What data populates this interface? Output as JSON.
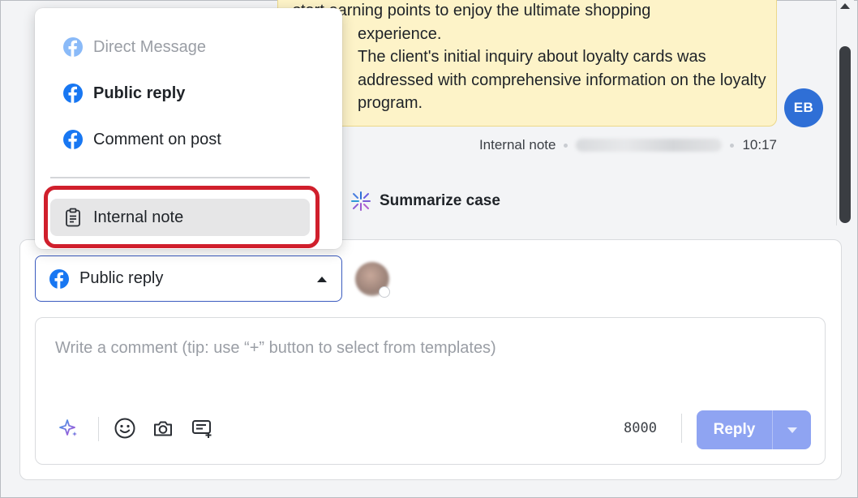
{
  "note": {
    "lines": [
      "start earning points to enjoy the ultimate shopping",
      "experience.",
      "The client's initial inquiry about loyalty cards was",
      "addressed with comprehensive information on the loyalty",
      "program."
    ],
    "author_initials": "EB",
    "type_label": "Internal note",
    "time": "10:17"
  },
  "summarize": {
    "label": "Summarize case"
  },
  "menu": {
    "items": [
      {
        "label": "Direct Message",
        "icon": "facebook-icon",
        "state": "disabled"
      },
      {
        "label": "Public reply",
        "icon": "facebook-icon",
        "state": "selected"
      },
      {
        "label": "Comment on post",
        "icon": "facebook-icon",
        "state": "normal"
      },
      {
        "label": "Internal note",
        "icon": "clipboard-icon",
        "state": "hover"
      }
    ]
  },
  "composer": {
    "channel": {
      "label": "Public reply",
      "icon": "facebook-icon"
    },
    "comment": {
      "value": "",
      "placeholder": "Write a comment (tip: use “+” button to select from templates)"
    },
    "char_count": "8000",
    "reply_label": "Reply"
  },
  "colors": {
    "facebook": "#1877f2",
    "note_bg": "#fdf3c8",
    "reply_bg": "#8fa4f2",
    "highlight": "#d01f2c",
    "avatar": "#2f6fd6"
  }
}
